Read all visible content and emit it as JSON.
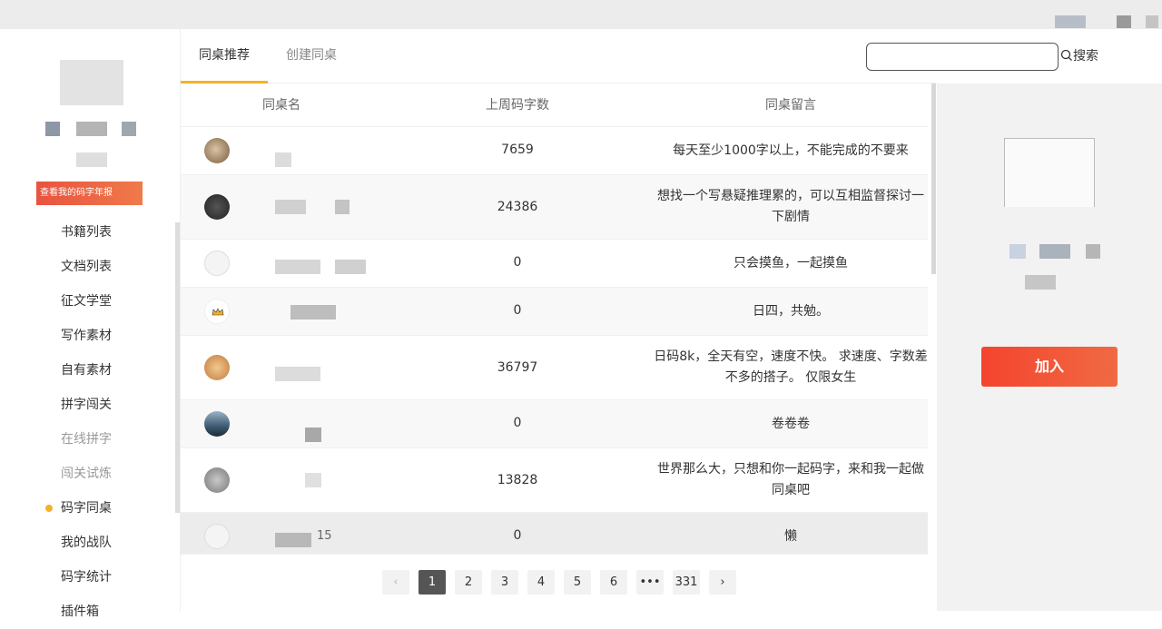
{
  "tabs": {
    "active": "同桌推荐",
    "inactive": "创建同桌"
  },
  "search": {
    "placeholder": "",
    "button": "搜索"
  },
  "sidebar": {
    "banner": "查看我的码字年报",
    "items": [
      {
        "label": "书籍列表"
      },
      {
        "label": "文档列表"
      },
      {
        "label": "征文学堂"
      },
      {
        "label": "写作素材"
      },
      {
        "label": "自有素材"
      },
      {
        "label": "拼字闯关"
      },
      {
        "label": "在线拼字"
      },
      {
        "label": "闯关试炼"
      },
      {
        "label": "码字同桌"
      },
      {
        "label": "我的战队"
      },
      {
        "label": "码字统计"
      },
      {
        "label": "插件箱"
      }
    ]
  },
  "table": {
    "headers": {
      "name": "同桌名",
      "words": "上周码字数",
      "message": "同桌留言"
    },
    "rows": [
      {
        "words": "7659",
        "message": "每天至少1000字以上，不能完成的不要来"
      },
      {
        "words": "24386",
        "message": "想找一个写悬疑推理累的，可以互相监督探讨一下剧情"
      },
      {
        "words": "0",
        "message": "只会摸鱼，一起摸鱼"
      },
      {
        "words": "0",
        "message": "日四，共勉。"
      },
      {
        "words": "36797",
        "message": "日码8k，全天有空，速度不快。 求速度、字数差不多的搭子。 仅限女生"
      },
      {
        "words": "0",
        "message": "卷卷卷"
      },
      {
        "words": "13828",
        "message": "世界那么大，只想和你一起码字，来和我一起做同桌吧"
      },
      {
        "words": "0",
        "message": "懒",
        "name_suffix": "15"
      }
    ]
  },
  "pagination": {
    "pages": [
      "1",
      "2",
      "3",
      "4",
      "5",
      "6",
      "•••",
      "331"
    ],
    "prev": "‹",
    "next": "›"
  },
  "right": {
    "join": "加入"
  },
  "colors": {
    "accent": "#f4b22a",
    "join": "#f4442e"
  }
}
